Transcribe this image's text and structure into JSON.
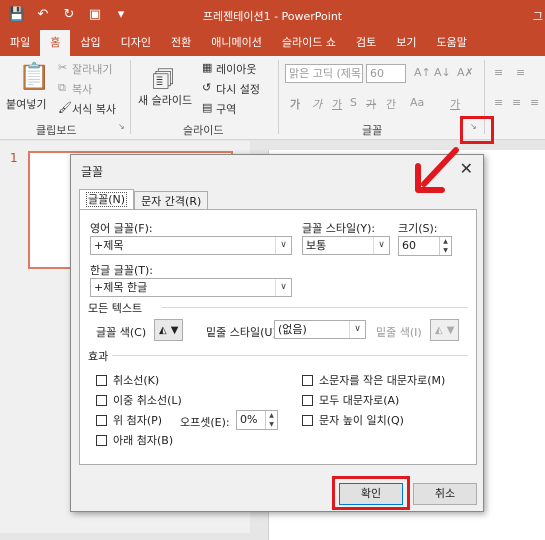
{
  "window": {
    "title": "프레젠테이션1 - PowerPoint",
    "right_fragment": "그"
  },
  "qat": {
    "icons": [
      "save-icon",
      "undo-icon",
      "redo-icon",
      "present-icon",
      "customize-icon"
    ]
  },
  "tabs": [
    "파일",
    "홈",
    "삽입",
    "디자인",
    "전환",
    "애니메이션",
    "슬라이드 쇼",
    "검토",
    "보기",
    "도움말"
  ],
  "ribbon": {
    "clipboard": {
      "paste": "붙여넣기",
      "cut": "잘라내기",
      "copy": "복사",
      "format_painter": "서식 복사",
      "label": "클립보드"
    },
    "slides": {
      "new_slide": "새 슬라이드",
      "layout": "레이아웃",
      "reset": "다시 설정",
      "section": "구역",
      "label": "슬라이드"
    },
    "font": {
      "font_name": "맑은 고딕 (제목",
      "font_size": "60",
      "label": "글꼴"
    }
  },
  "thumbnail": {
    "number": "1"
  },
  "dialog": {
    "title": "글꼴",
    "tabs": [
      "글꼴(N)",
      "문자 간격(R)"
    ],
    "latin_font_label": "영어 글꼴(F):",
    "latin_font_value": "+제목",
    "font_style_label": "글꼴 스타일(Y):",
    "font_style_value": "보통",
    "size_label": "크기(S):",
    "size_value": "60",
    "asian_font_label": "한글 글꼴(T):",
    "asian_font_value": "+제목 한글",
    "all_text_label": "모든 텍스트",
    "font_color_label": "글꼴 색(C)",
    "underline_style_label": "밑줄 스타일(U)",
    "underline_style_value": "(없음)",
    "underline_color_label": "밑줄 색(I)",
    "effects_label": "효과",
    "effects_left": [
      "취소선(K)",
      "이중 취소선(L)",
      "위 첨자(P)",
      "아래 첨자(B)"
    ],
    "offset_label": "오프셋(E):",
    "offset_value": "0%",
    "effects_right": [
      "소문자를 작은 대문자로(M)",
      "모두 대문자로(A)",
      "문자 높이 일치(Q)"
    ],
    "ok": "확인",
    "cancel": "취소"
  },
  "colors": {
    "brand": "#c5482b",
    "highlight": "#e0191e"
  }
}
